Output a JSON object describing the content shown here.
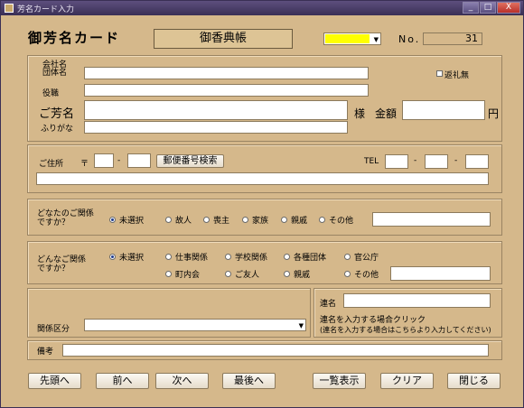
{
  "window": {
    "title": "芳名カード入力",
    "controls": [
      "_",
      "□",
      "X"
    ]
  },
  "header": {
    "card_title": "御芳名カード",
    "book_label": "御香典帳",
    "no_label": "No.",
    "no_value": "31",
    "color_select_value": ""
  },
  "person": {
    "company_label": "会社名\n団体名",
    "company_value": "",
    "title_label": "役職",
    "title_value": "",
    "name_label": "ご芳名",
    "name_value": "",
    "furigana_label": "ふりがな",
    "furigana_value": "",
    "sama_label": "様",
    "amount_label": "金額",
    "amount_value": "",
    "yen_label": "円",
    "return_gift_label": "返礼無"
  },
  "address": {
    "label": "ご住所",
    "postal_mark": "〒",
    "dash": "-",
    "postal_search_button": "郵便番号検索",
    "tel_label": "TEL",
    "address_value": ""
  },
  "relation_who": {
    "label": "どなたのご関係\nですか？",
    "options": [
      "未選択",
      "故人",
      "喪主",
      "家族",
      "親戚",
      "その他"
    ],
    "other_value": ""
  },
  "relation_kind": {
    "label": "どんなご関係\nですか？",
    "row1": [
      "未選択",
      "仕事関係",
      "学校関係",
      "各種団体",
      "官公庁"
    ],
    "row2": [
      "町内会",
      "ご友人",
      "親戚",
      "その他"
    ],
    "other_value": ""
  },
  "category": {
    "label": "関係区分",
    "value": ""
  },
  "joint": {
    "label": "連名",
    "value": "",
    "click_hint": "連名を入力する場合クリック",
    "click_note": "(連名を入力する場合はこちらより入力してください)"
  },
  "notes": {
    "label": "備考",
    "value": ""
  },
  "footer": {
    "buttons": [
      "先頭へ",
      "前へ",
      "次へ",
      "最後へ",
      "一覧表示",
      "クリア",
      "閉じる"
    ]
  },
  "colors": {
    "background": "#d5b88b",
    "selector": "#ffff00",
    "titlebar": "#3a2f55"
  }
}
